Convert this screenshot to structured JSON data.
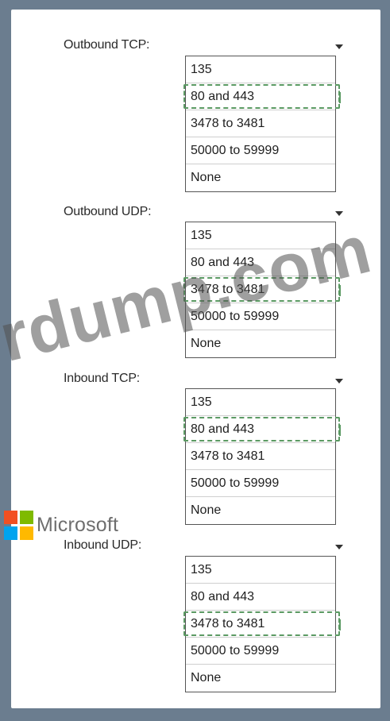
{
  "groups": [
    {
      "label": "Outbound TCP:",
      "options": [
        "135",
        "80 and 443",
        "3478 to 3481",
        "50000 to 59999",
        "None"
      ],
      "selected_index": 1
    },
    {
      "label": "Outbound UDP:",
      "options": [
        "135",
        "80 and 443",
        "3478 to 3481",
        "50000 to 59999",
        "None"
      ],
      "selected_index": 2
    },
    {
      "label": "Inbound TCP:",
      "options": [
        "135",
        "80 and 443",
        "3478 to 3481",
        "50000 to 59999",
        "None"
      ],
      "selected_index": 1
    },
    {
      "label": "Inbound UDP:",
      "options": [
        "135",
        "80 and 443",
        "3478 to 3481",
        "50000 to 59999",
        "None"
      ],
      "selected_index": 2
    }
  ],
  "watermark": "rdump.com",
  "logo": {
    "text": "Microsoft",
    "colors": [
      "#f25022",
      "#7fba00",
      "#00a4ef",
      "#ffb900"
    ]
  },
  "colors": {
    "background": "#6b7d8f",
    "selection_highlight": "#5b9a63"
  }
}
